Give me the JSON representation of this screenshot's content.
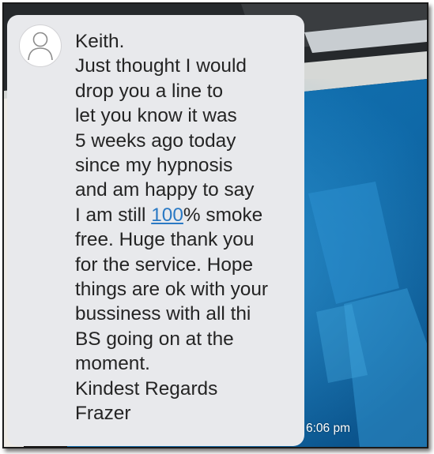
{
  "message": {
    "line1": "Keith.",
    "line2": "Just thought I would",
    "line3": "drop you a line to",
    "line4": "let you know it was",
    "line5": "5 weeks ago today",
    "line6": "since my hypnosis",
    "line7": "and am happy to say",
    "line8_before": "I am still ",
    "line8_link": "100",
    "line8_after": "% smoke",
    "line9": "free. Huge thank you",
    "line10": "for the service. Hope",
    "line11": "things are ok with your",
    "line12": "bussiness with all thi",
    "line13": "BS going on at the",
    "line14": "moment.",
    "line15": "Kindest Regards",
    "line16": "Frazer"
  },
  "timestamp": "6:06 pm",
  "avatar_icon": "person-silhouette-icon",
  "colors": {
    "bubble": "#e8e9ec",
    "text": "#242424",
    "link": "#2a79c4",
    "pool_water": "#1c7cc0",
    "timestamp": "#ffffff"
  }
}
